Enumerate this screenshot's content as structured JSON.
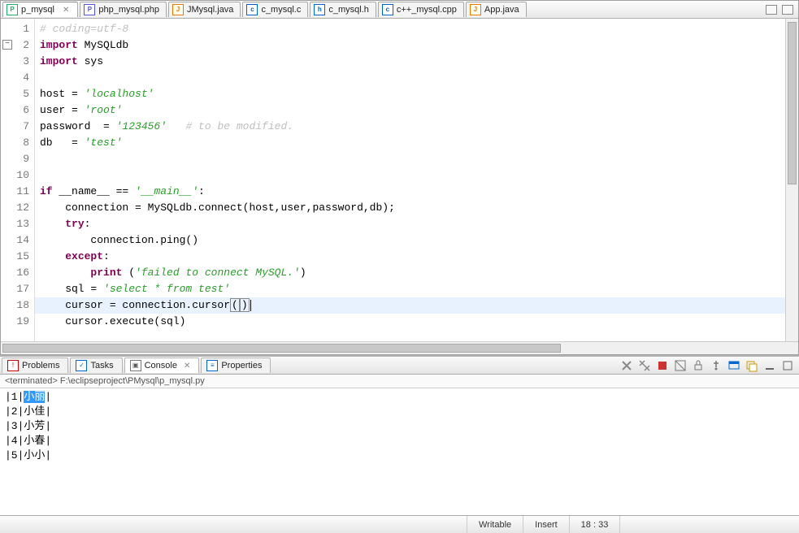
{
  "tabs": [
    {
      "icon": "py",
      "icon_text": "P",
      "label": "p_mysql",
      "active": true,
      "closeable": true
    },
    {
      "icon": "php",
      "icon_text": "P",
      "label": "php_mysql.php"
    },
    {
      "icon": "java",
      "icon_text": "J",
      "label": "JMysql.java"
    },
    {
      "icon": "c",
      "icon_text": "c",
      "label": "c_mysql.c"
    },
    {
      "icon": "h",
      "icon_text": "h",
      "label": "c_mysql.h"
    },
    {
      "icon": "cpp",
      "icon_text": "c",
      "label": "c++_mysql.cpp"
    },
    {
      "icon": "java",
      "icon_text": "J",
      "label": "App.java"
    }
  ],
  "code_lines": [
    {
      "n": "1",
      "html": "<span class='cm'># coding=utf-8</span>"
    },
    {
      "n": "2",
      "fold": true,
      "html": "<span class='kw'>import</span> MySQLdb"
    },
    {
      "n": "3",
      "html": "<span class='kw'>import</span> sys"
    },
    {
      "n": "4",
      "html": ""
    },
    {
      "n": "5",
      "html": "host = <span class='str'>'localhost'</span>"
    },
    {
      "n": "6",
      "html": "user = <span class='str'>'root'</span>"
    },
    {
      "n": "7",
      "html": "password  = <span class='str'>'123456'</span>   <span class='cm'># to be modified.</span>"
    },
    {
      "n": "8",
      "html": "db   = <span class='str'>'test'</span>"
    },
    {
      "n": "9",
      "html": ""
    },
    {
      "n": "10",
      "html": ""
    },
    {
      "n": "11",
      "html": "<span class='kw'>if</span> __name__ == <span class='str'>'__main__'</span>:"
    },
    {
      "n": "12",
      "html": "    connection = MySQLdb.connect(host,user,password,db);"
    },
    {
      "n": "13",
      "html": "    <span class='kw'>try</span>:"
    },
    {
      "n": "14",
      "html": "        connection.ping()"
    },
    {
      "n": "15",
      "html": "    <span class='kw'>except</span>:"
    },
    {
      "n": "16",
      "html": "        <span class='kw'>print</span> (<span class='str'>'failed to connect MySQL.'</span>)"
    },
    {
      "n": "17",
      "html": "    sql = <span class='str'>'select * from test'</span>"
    },
    {
      "n": "18",
      "hl": true,
      "html": "    cursor = connection.cursor<span class='bmatch'>(</span><span class='bmatch'>)</span><span class='caret'></span>"
    },
    {
      "n": "19",
      "html": "    cursor.execute(sql)"
    }
  ],
  "lower_tabs": [
    {
      "icon": "problems",
      "icon_text": "!",
      "label": "Problems"
    },
    {
      "icon": "tasks",
      "icon_text": "✓",
      "label": "Tasks"
    },
    {
      "icon": "console",
      "icon_text": "▣",
      "label": "Console",
      "active": true,
      "closeable": true
    },
    {
      "icon": "props",
      "icon_text": "≡",
      "label": "Properties"
    }
  ],
  "console": {
    "header": "<terminated> F:\\eclipseproject\\PMysql\\p_mysql.py",
    "rows": [
      {
        "id": "1",
        "name": "小丽",
        "selected": true
      },
      {
        "id": "2",
        "name": "小佳"
      },
      {
        "id": "3",
        "name": "小芳"
      },
      {
        "id": "4",
        "name": "小春"
      },
      {
        "id": "5",
        "name": "小小"
      }
    ]
  },
  "status": {
    "writable": "Writable",
    "insert": "Insert",
    "pos": "18 : 33"
  }
}
